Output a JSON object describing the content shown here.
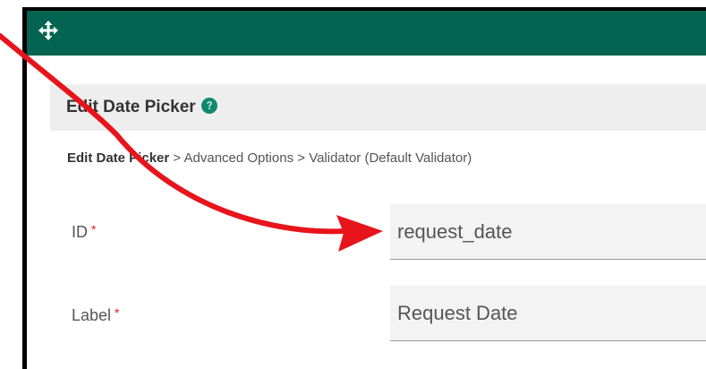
{
  "dialog": {
    "title": "Edit Date Picker",
    "breadcrumb": {
      "current": "Edit Date Picker",
      "separator": " > ",
      "items": [
        "Advanced Options",
        "Validator (Default Validator)"
      ]
    }
  },
  "form": {
    "id_field": {
      "label": "ID",
      "required_marker": "*",
      "value": "request_date"
    },
    "label_field": {
      "label": "Label",
      "required_marker": "*",
      "value": "Request Date"
    }
  },
  "colors": {
    "titlebar": "#036451",
    "help_icon": "#0f8a6e",
    "required": "#e02020",
    "annotation_arrow": "#e8141b"
  },
  "icons": {
    "move": "move-arrows-icon",
    "help": "question-circle-icon"
  }
}
